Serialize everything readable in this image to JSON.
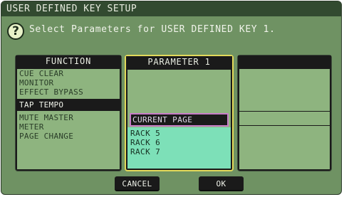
{
  "window": {
    "title": "USER DEFINED KEY SETUP"
  },
  "prompt": {
    "text": "Select Parameters for USER DEFINED KEY 1.",
    "icon": "question-icon"
  },
  "function_column": {
    "header": "FUNCTION",
    "items": [
      {
        "label": "CUE CLEAR",
        "selected": false
      },
      {
        "label": "MONITOR",
        "selected": false
      },
      {
        "label": "EFFECT BYPASS",
        "selected": false
      },
      {
        "label": "TAP TEMPO",
        "selected": true
      },
      {
        "label": "MUTE MASTER",
        "selected": false
      },
      {
        "label": "METER",
        "selected": false
      },
      {
        "label": "PAGE CHANGE",
        "selected": false
      }
    ]
  },
  "parameter_column": {
    "header": "PARAMETER 1",
    "current": "CURRENT PAGE",
    "items": [
      "RACK 5",
      "RACK 6",
      "RACK 7"
    ]
  },
  "buttons": {
    "cancel": "CANCEL",
    "ok": "OK"
  },
  "colors": {
    "panel": "#6f9263",
    "selection_border": "#e3d95a",
    "current_border": "#c77ec8",
    "list_teal": "#7de0b8"
  }
}
